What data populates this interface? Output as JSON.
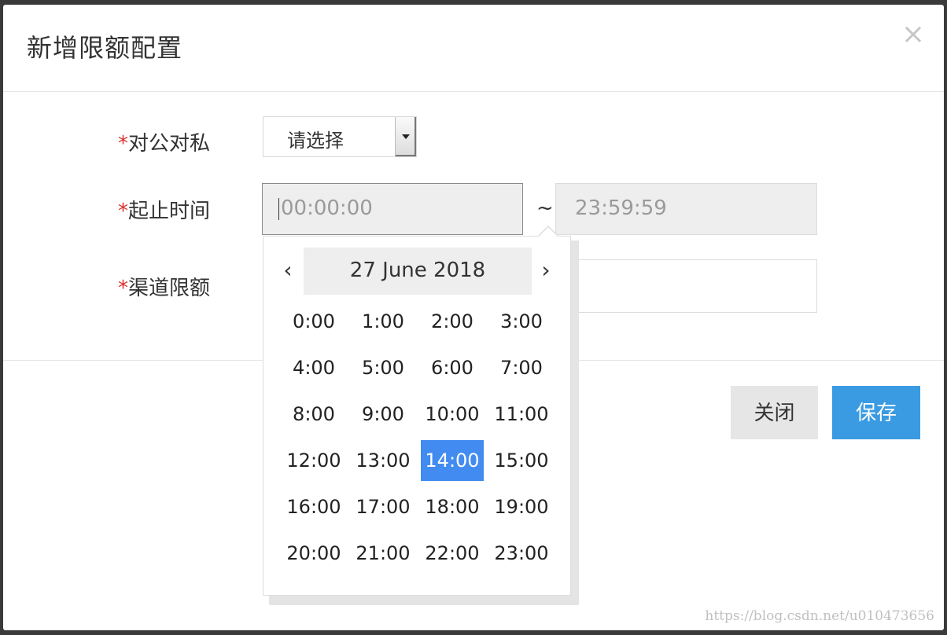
{
  "dialog": {
    "title": "新增限额配置",
    "close_glyph": "×"
  },
  "form": {
    "required_mark": "*",
    "business_type": {
      "label": "对公对私",
      "selected": "请选择"
    },
    "time_range": {
      "label": "起止时间",
      "start_placeholder": "00:00:00",
      "separator": "~",
      "end_placeholder": "23:59:59"
    },
    "channel_limit": {
      "label": "渠道限额",
      "value": ""
    }
  },
  "picker": {
    "prev_glyph": "‹",
    "next_glyph": "›",
    "title": "27 June 2018",
    "selected_hour": "14:00",
    "hours": [
      "0:00",
      "1:00",
      "2:00",
      "3:00",
      "4:00",
      "5:00",
      "6:00",
      "7:00",
      "8:00",
      "9:00",
      "10:00",
      "11:00",
      "12:00",
      "13:00",
      "14:00",
      "15:00",
      "16:00",
      "17:00",
      "18:00",
      "19:00",
      "20:00",
      "21:00",
      "22:00",
      "23:00"
    ]
  },
  "footer": {
    "close_label": "关闭",
    "save_label": "保存"
  },
  "watermark": "https://blog.csdn.net/u010473656",
  "colors": {
    "accent": "#3a9be2",
    "selected_hour": "#428bf1",
    "required": "#d9302c"
  },
  "icons": {
    "close": "close-icon",
    "prev": "chevron-left-icon",
    "next": "chevron-right-icon",
    "dropdown": "caret-down-icon"
  }
}
